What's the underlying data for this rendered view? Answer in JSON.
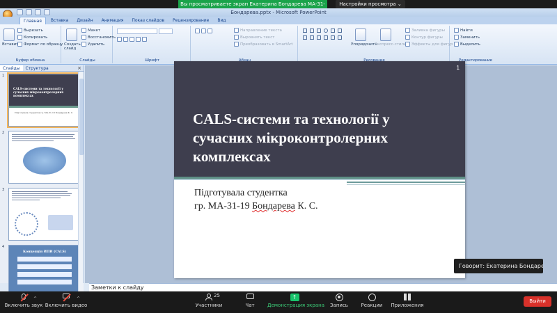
{
  "zoom_top": {
    "share_banner": "Вы просматриваете экран Екатерина Бондарева МА-31-19",
    "view_settings": "Настройки просмотра",
    "view_settings_caret": "⌄"
  },
  "ppt": {
    "window_title": "Бондарева.pptx - Microsoft PowerPoint",
    "tabs": [
      "Главная",
      "Вставка",
      "Дизайн",
      "Анимация",
      "Показ слайдов",
      "Рецензирование",
      "Вид"
    ],
    "ribbon": {
      "clipboard": {
        "paste": "Вставить",
        "cut": "Вырезать",
        "copy": "Копировать",
        "format_painter": "Формат по образцу",
        "label": "Буфер обмена"
      },
      "slides": {
        "create": "Создать слайд",
        "layout": "Макет",
        "reset": "Восстановить",
        "delete": "Удалить",
        "label": "Слайды"
      },
      "font": {
        "label": "Шрифт"
      },
      "paragraph": {
        "text_direction": "Направление текста",
        "align_text": "Выровнять текст",
        "smartart": "Преобразовать в SmartArt",
        "label": "Абзац"
      },
      "drawing": {
        "arrange": "Упорядочить",
        "quick_styles": "Экспресс-стили",
        "fill": "Заливка фигуры",
        "outline": "Контур фигуры",
        "effects": "Эффекты для фигур",
        "label": "Рисование"
      },
      "editing": {
        "find": "Найти",
        "replace": "Заменить",
        "select": "Выделить",
        "label": "Редактирование"
      }
    },
    "left_pane": {
      "tab_slides": "Слайды",
      "tab_outline": "Структура",
      "close": "×",
      "thumbnails": [
        {
          "number": "1",
          "title": "CALS-системи та технології у сучасних мікроконтролерних комплексах",
          "subtitle": "Підготувала студентка гр. МА-31-19 Бондарева К. С."
        },
        {
          "number": "2"
        },
        {
          "number": "3"
        },
        {
          "number": "4",
          "title": "Концепція ИПИ (CALS)"
        }
      ]
    },
    "slide": {
      "number": "1",
      "title": "CALS-системи та технології у сучасних мікроконтролерних комплексах",
      "subtitle_line1": "Підготувала студентка",
      "subtitle_line2_prefix": "гр. МА-31-19 ",
      "subtitle_line2_name": "Бондарева",
      "subtitle_line2_suffix": " К. С."
    },
    "notes_placeholder": "Заметки к слайду"
  },
  "speaker_popup": "Говорит: Екатерина Бондарев...",
  "zoom_bar": {
    "unmute": "Включить звук",
    "start_video": "Включить видео",
    "participants": "Участники",
    "participants_count": "25",
    "chat": "Чат",
    "share_screen": "Демонстрация экрана",
    "record": "Запись",
    "reactions": "Реакции",
    "apps": "Приложения",
    "leave": "Выйти"
  }
}
